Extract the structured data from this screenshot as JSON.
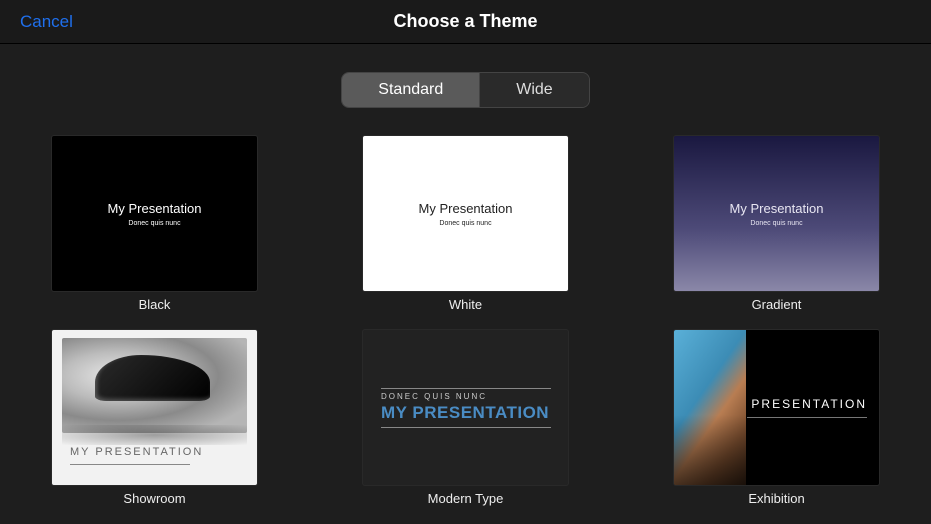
{
  "header": {
    "cancel": "Cancel",
    "title": "Choose a Theme"
  },
  "segments": {
    "standard": "Standard",
    "wide": "Wide",
    "selected": "Standard"
  },
  "sample": {
    "title": "My Presentation",
    "title_upper": "MY PRESENTATION",
    "subtitle": "Donec quis nunc",
    "subtitle_upper": "DONEC QUIS NUNC"
  },
  "themes": [
    {
      "id": "black",
      "label": "Black"
    },
    {
      "id": "white",
      "label": "White"
    },
    {
      "id": "gradient",
      "label": "Gradient"
    },
    {
      "id": "showroom",
      "label": "Showroom"
    },
    {
      "id": "modern",
      "label": "Modern Type"
    },
    {
      "id": "exhibition",
      "label": "Exhibition"
    }
  ]
}
